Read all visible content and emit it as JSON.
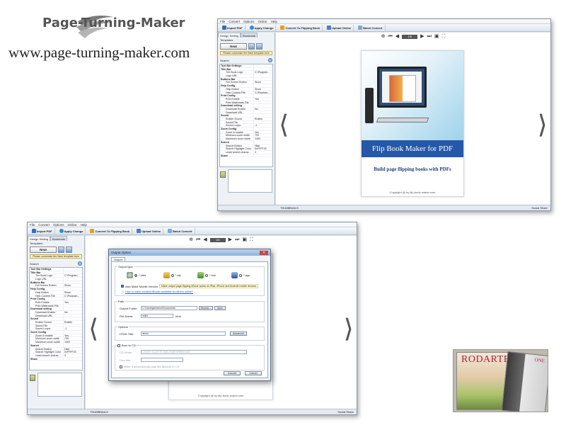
{
  "brand": {
    "logo_text": "Page-Turning-Maker",
    "url": "www.page-turning-maker.com"
  },
  "menu": [
    "File",
    "Convert",
    "Options",
    "Online",
    "Help"
  ],
  "toolbar": {
    "import": "Import PDF",
    "apply": "Apply Change",
    "convert": "Convert To Flipping Book",
    "upload": "Upload Online",
    "batch": "Batch Convert"
  },
  "sidebar": {
    "tab_design": "Design Setting",
    "tab_bookmark": "Bookmark",
    "templates_label": "Templates",
    "template_name": "Neat",
    "customize": "Please customize the flash template here",
    "search_label": "Search",
    "properties": [
      {
        "k": "Tool Bar Settings",
        "v": "",
        "grp": true
      },
      {
        "k": "Title Bar",
        "v": "",
        "grp": true
      },
      {
        "k": "The Book Logo",
        "v": "C:\\Program...",
        "grp": false
      },
      {
        "k": "Logo URL",
        "v": "",
        "grp": false
      },
      {
        "k": "Buttons Bar",
        "v": "",
        "grp": true
      },
      {
        "k": "Full Screen Button",
        "v": "Show",
        "grp": false
      },
      {
        "k": "Help Config",
        "v": "",
        "grp": true
      },
      {
        "k": "Help Button",
        "v": "Show",
        "grp": false
      },
      {
        "k": "Help Content File",
        "v": "C:\\Program...",
        "grp": false
      },
      {
        "k": "Print Config",
        "v": "",
        "grp": true
      },
      {
        "k": "Print Enable",
        "v": "Yes",
        "grp": false
      },
      {
        "k": "Print Watermark File",
        "v": "",
        "grp": false
      },
      {
        "k": "Download setting",
        "v": "",
        "grp": true
      },
      {
        "k": "Download Enable",
        "v": "No",
        "grp": false
      },
      {
        "k": "Download URL",
        "v": "",
        "grp": false
      },
      {
        "k": "Sound",
        "v": "",
        "grp": true
      },
      {
        "k": "Enable Sound",
        "v": "Enable",
        "grp": false
      },
      {
        "k": "Sound File",
        "v": "",
        "grp": false
      },
      {
        "k": "Sound Loops",
        "v": "-1",
        "grp": false
      },
      {
        "k": "Zoom Config",
        "v": "",
        "grp": true
      },
      {
        "k": "Zoom in enable",
        "v": "Yes",
        "grp": false
      },
      {
        "k": "Minimum zoom width",
        "v": "700",
        "grp": false
      },
      {
        "k": "Maximum zoom width",
        "v": "1400",
        "grp": false
      },
      {
        "k": "Search",
        "v": "",
        "grp": true
      },
      {
        "k": "Search Button",
        "v": "Hide",
        "grp": false
      },
      {
        "k": "Search Highlight Color",
        "v": "0xFFFF00",
        "grp": false
      },
      {
        "k": "Least search charac...",
        "v": "3",
        "grp": false
      },
      {
        "k": "Share",
        "v": "",
        "grp": true
      }
    ]
  },
  "viewer": {
    "page_indicator": "1/6",
    "prev_glyph": "❮",
    "next_glyph": "❯"
  },
  "book": {
    "title": "Flip Book Maker for PDF",
    "subtitle": "Build page flipping books with PDFs",
    "copyright": "Copyright @ by flip-book-maker.com"
  },
  "status": {
    "thumbnails": "THUMBNAILS",
    "social": "Social Share"
  },
  "dialog": {
    "title": "Output Option",
    "tab": "Output",
    "output_type_label": "Output type",
    "types": [
      "*.html",
      "*.zip",
      "*.exe",
      "*.app"
    ],
    "selected_type": "*.html",
    "mobile_check": "Also Make Mobile Version",
    "mobile_hint": "Make output page-flipping eBook works on iPad, iPhone and Android mobile devices",
    "mobile_link": "How to make created eBooks available for others online?",
    "path_label": "Path",
    "output_folder_label": "Output Folder:",
    "output_folder": "C:\\Users\\jacharon\\Documents",
    "browse": "Browse...",
    "open": "Open",
    "file_name_label": "File Name:",
    "file_name": "index",
    "file_ext": ".html",
    "options_label": "Options",
    "html_title_label": "HTML Title:",
    "html_title": "demo",
    "advanced": "Advanced",
    "burn_cd": "Burn to CD",
    "cd_writer_label": "CD Writer:",
    "cd_writer": "1:0:0,E: HL-DT-ST DVD-ROM DH40N    A101",
    "disc_title_label": "Disc title:",
    "autoplay": "Make it automatically play the flipbook in CD",
    "convert": "Convert",
    "cancel": "Cancel"
  },
  "magazine": {
    "cover_title": "RODARTE",
    "open_title": "ONE"
  },
  "colors": {
    "accent_blue": "#2558a8",
    "window_frame": "#dfe6ee"
  }
}
